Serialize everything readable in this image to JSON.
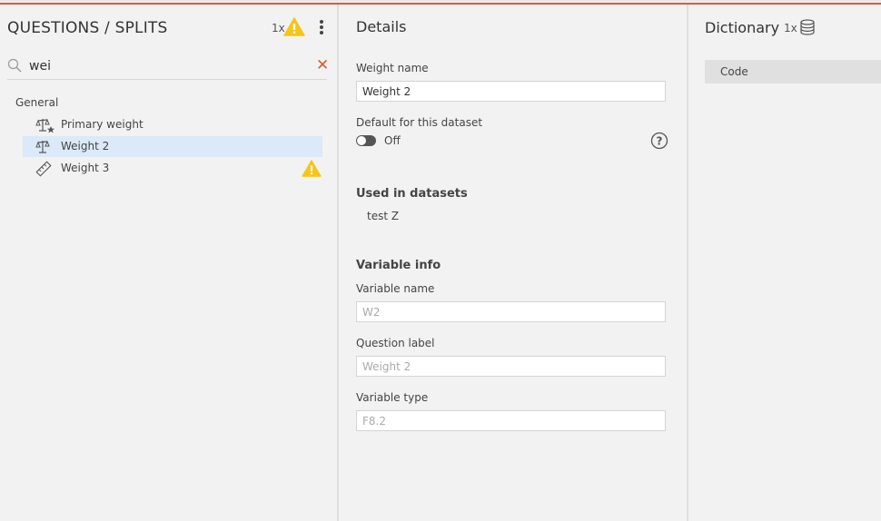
{
  "left_panel": {
    "title": "QUESTIONS / SPLITS",
    "warning_count": "1x",
    "search": {
      "value": "wei",
      "clear_glyph": "✕"
    },
    "group_label": "General",
    "items": [
      {
        "label": "Primary weight",
        "icon": "weight-scale-star-icon",
        "selected": false,
        "warning": false
      },
      {
        "label": "Weight 2",
        "icon": "weight-scale-icon",
        "selected": true,
        "warning": false
      },
      {
        "label": "Weight 3",
        "icon": "ruler-icon",
        "selected": false,
        "warning": true
      }
    ]
  },
  "details": {
    "title": "Details",
    "weight_name_label": "Weight name",
    "weight_name_value": "Weight 2",
    "default_label": "Default for this dataset",
    "default_toggle_state": "Off",
    "used_in_title": "Used in datasets",
    "datasets": [
      "test Z"
    ],
    "variable_info_title": "Variable info",
    "variable_name_label": "Variable name",
    "variable_name_value": "W2",
    "question_label_label": "Question label",
    "question_label_value": "Weight 2",
    "variable_type_label": "Variable type",
    "variable_type_value": "F8.2"
  },
  "dictionary": {
    "title": "Dictionary",
    "count": "1x",
    "column_header": "Code"
  },
  "colors": {
    "accent": "#e2572b",
    "selection": "#dbe9f9",
    "warning": "#f5c518"
  }
}
